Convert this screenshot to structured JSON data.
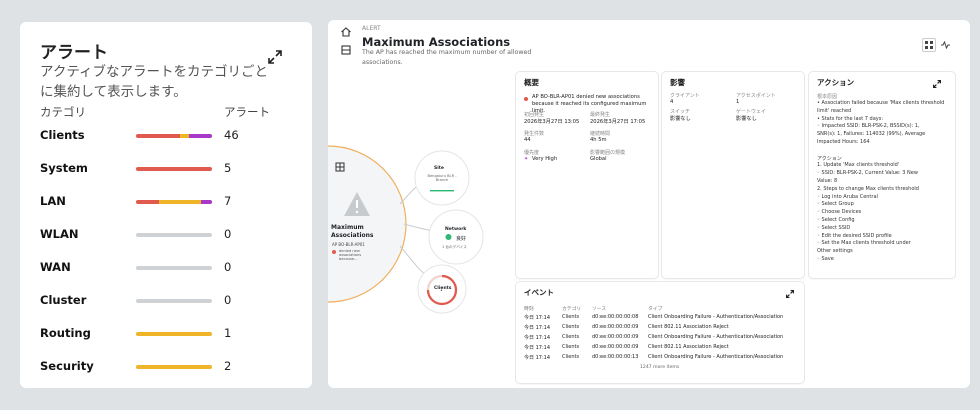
{
  "left": {
    "title": "アラート",
    "description": "アクティブなアラートをカテゴリごとに集約して表示します。",
    "col_category": "カテゴリ",
    "col_alerts": "アラート",
    "rows": [
      {
        "label": "Clients",
        "count": "46",
        "segments": [
          {
            "color": "#e05a4e",
            "frac": 0.58
          },
          {
            "color": "#f0b429",
            "frac": 0.12
          },
          {
            "color": "#a838c8",
            "frac": 0.3
          }
        ]
      },
      {
        "label": "System",
        "count": "5",
        "segments": [
          {
            "color": "#e05a4e",
            "frac": 1.0
          }
        ]
      },
      {
        "label": "LAN",
        "count": "7",
        "segments": [
          {
            "color": "#e05a4e",
            "frac": 0.3
          },
          {
            "color": "#f0b429",
            "frac": 0.56
          },
          {
            "color": "#a838c8",
            "frac": 0.14
          }
        ]
      },
      {
        "label": "WLAN",
        "count": "0",
        "segments": []
      },
      {
        "label": "WAN",
        "count": "0",
        "segments": []
      },
      {
        "label": "Cluster",
        "count": "0",
        "segments": []
      },
      {
        "label": "Routing",
        "count": "1",
        "segments": [
          {
            "color": "#f0b429",
            "frac": 1.0
          }
        ]
      },
      {
        "label": "Security",
        "count": "2",
        "segments": [
          {
            "color": "#f0b429",
            "frac": 1.0
          }
        ]
      }
    ]
  },
  "alert": {
    "label": "ALERT",
    "title": "Maximum Associations",
    "subtitle": "The AP has reached the maximum number of allowed associations."
  },
  "topology": {
    "main_title": "Maximum Associations",
    "main_ap": "AP BO-BLR-AP01",
    "main_note": "denied new associations because...",
    "site_label": "Site",
    "site_value": "Bengaluru BLR - Branch",
    "network_label": "Network",
    "network_status": "良好",
    "network_devices": "1 台のデバイス",
    "clients_label": "Clients",
    "clients_value": "1"
  },
  "overview": {
    "title": "概要",
    "message": "AP BO-BLR-AP01 denied new associations because it reached its configured maximum limit.",
    "first_seen_label": "初回発生",
    "first_seen": "2026年3月27日 13:05",
    "last_seen_label": "最終発生",
    "last_seen": "2026年3月27日 17:05",
    "count_label": "発生件数",
    "count": "44",
    "duration_label": "継続時間",
    "duration": "4h 5m",
    "priority_label": "優先度",
    "priority": "Very High",
    "scope_label": "影響範囲の規模",
    "scope": "Global"
  },
  "impact": {
    "title": "影響",
    "clients_label": "クライアント",
    "clients": "4",
    "aps_label": "アクセスポイント",
    "aps": "1",
    "switch_label": "スイッチ",
    "switch": "影響なし",
    "gateway_label": "ゲートウェイ",
    "gateway": "影響なし"
  },
  "action": {
    "title": "アクション",
    "basis_label": "根本原因",
    "lines": [
      "• Association failed because 'Max clients threshold",
      "  limit' reached",
      "• Stats for the last 7 days:",
      "    ◦ Impacted SSID: BLR-PSK-2, BSSID(s): 1,",
      "      SNR(s): 1, Failures: 114032 (99%), Average",
      "      Impacted Hours: 164",
      "",
      "アクション",
      "1. Update 'Max clients threshold'",
      "    ◦ SSID: BLR-PSK-2, Current Value: 3 New",
      "      Value: 8",
      "2. Steps to change Max clients threshold",
      "    ◦ Log into Aruba Central",
      "    ◦ Select Group",
      "    ◦ Choose Devices",
      "    ◦ Select Config",
      "    ◦ Select SSID",
      "    ◦ Edit the desired SSID profile",
      "    ◦ Set the Max clients threshold under",
      "      Other settings",
      "    ◦ Save"
    ]
  },
  "events": {
    "title": "イベント",
    "headers": [
      "時刻",
      "カテゴリ",
      "ソース",
      "タイプ"
    ],
    "rows": [
      [
        "今日 17:14",
        "Clients",
        "d0:ee:00:00:00:08",
        "Client Onboarding Failure - Authentication/Association"
      ],
      [
        "今日 17:14",
        "Clients",
        "d0:ee:00:00:00:09",
        "Client 802.11 Association Reject"
      ],
      [
        "今日 17:14",
        "Clients",
        "d0:ee:00:00:00:09",
        "Client Onboarding Failure - Authentication/Association"
      ],
      [
        "今日 17:14",
        "Clients",
        "d0:ee:00:00:00:09",
        "Client 802.11 Association Reject"
      ],
      [
        "今日 17:14",
        "Clients",
        "d0:ee:00:00:00:13",
        "Client Onboarding Failure - Authentication/Association"
      ]
    ],
    "more": "1247 more items"
  }
}
